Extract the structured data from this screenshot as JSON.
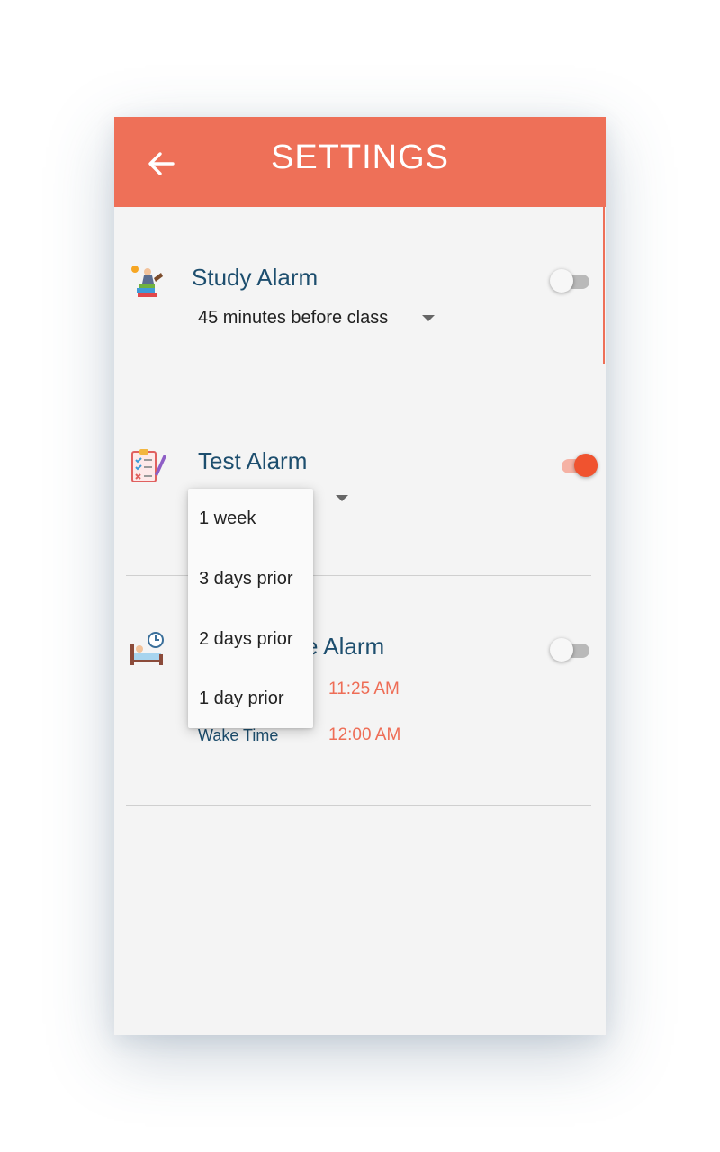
{
  "header": {
    "title": "SETTINGS",
    "back_icon": "arrow-left-icon",
    "color": "#ee7058"
  },
  "study_alarm": {
    "icon": "study-books-icon",
    "title": "Study Alarm",
    "selected_option": "45 minutes before class",
    "enabled": false
  },
  "test_alarm": {
    "icon": "test-checklist-icon",
    "title": "Test Alarm",
    "enabled": true,
    "menu_options": [
      "1 week",
      "3 days prior",
      "2 days prior",
      "1 day prior"
    ]
  },
  "sleep_alarm": {
    "icon": "bed-clock-icon",
    "title_partial": "e Alarm",
    "enabled": false,
    "bed_time_value": "11:25 AM",
    "wake_label": "Wake Time",
    "wake_time_value": "12:00 AM"
  },
  "colors": {
    "accent": "#ee7058",
    "toggle_on": "#f0532f",
    "title_text": "#1d4e6e",
    "time_text": "#ee6d56"
  }
}
